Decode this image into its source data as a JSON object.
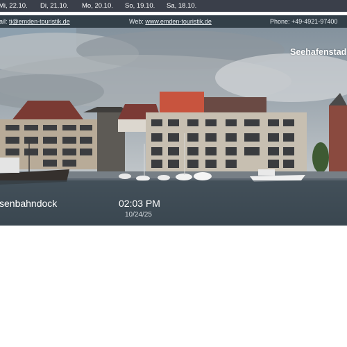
{
  "date_tabs": [
    "Mi, 22.10.",
    "Di, 21.10.",
    "Mo, 20.10.",
    "So, 19.10.",
    "Sa, 18.10."
  ],
  "info_bar": {
    "email_prefix": "ail: ",
    "email": "ti@emden-touristik.de",
    "web_prefix": "Web: ",
    "web": "www.emden-touristik.de",
    "phone": "Phone: +49-4921-97400"
  },
  "camera": {
    "title": "Seehafenstad",
    "location": "senbahndock",
    "time": "02:03 PM",
    "date": "10/24/25"
  }
}
